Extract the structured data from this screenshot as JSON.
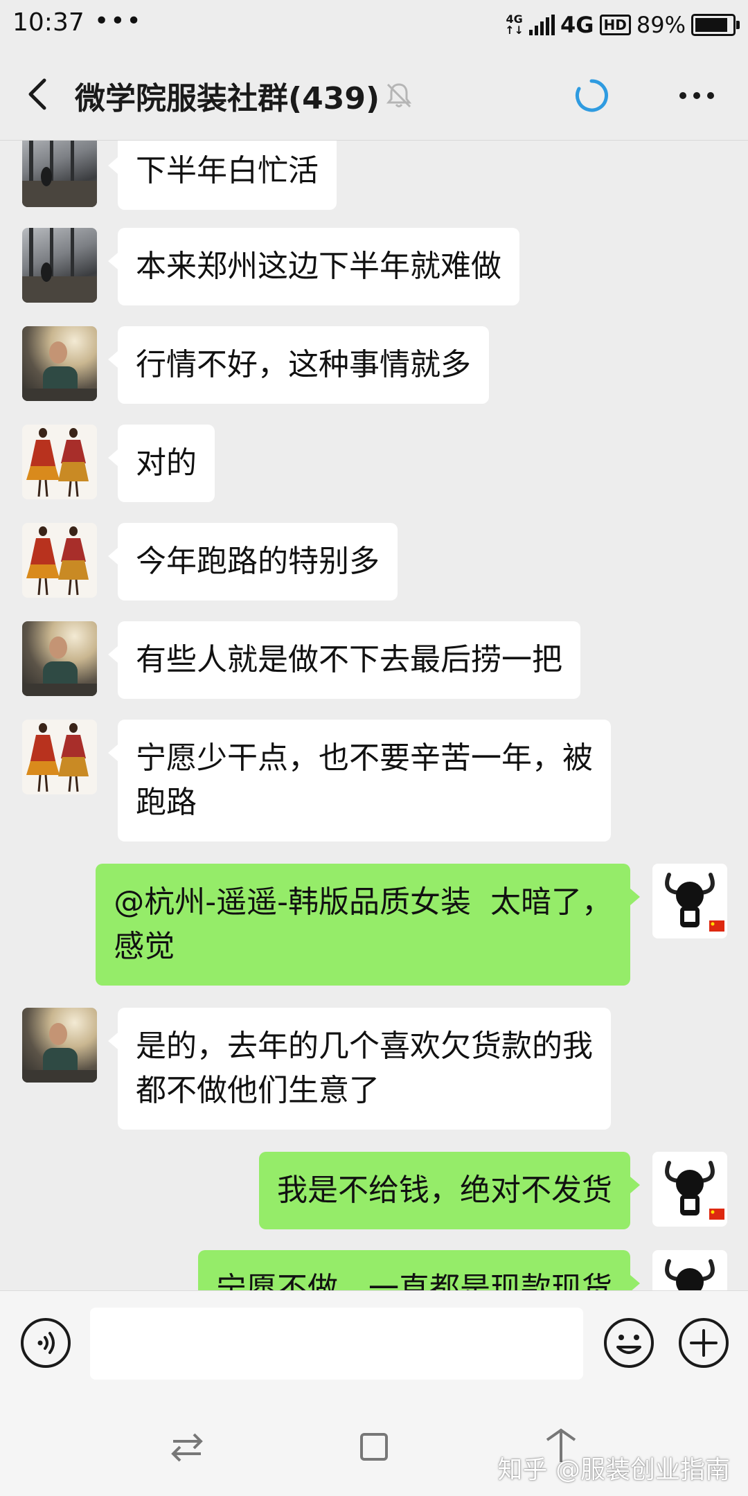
{
  "status_bar": {
    "time": "10:37",
    "dots": "•••",
    "mini_net": "4G",
    "network": "4G",
    "hd": "HD",
    "battery_percent": "89%",
    "battery_level": 0.89
  },
  "header": {
    "title": "微学院服装社群(439)",
    "accent_color": "#2f9be0"
  },
  "messages": [
    {
      "side": "left",
      "avatar": "room-photo",
      "text": "下半年白忙活"
    },
    {
      "side": "left",
      "avatar": "room-photo",
      "text": "本来郑州这边下半年就难做"
    },
    {
      "side": "left",
      "avatar": "man-photo",
      "text": "行情不好，这种事情就多"
    },
    {
      "side": "left",
      "avatar": "fashion-illustration",
      "text": "对的"
    },
    {
      "side": "left",
      "avatar": "fashion-illustration",
      "text": "今年跑路的特别多"
    },
    {
      "side": "left",
      "avatar": "man-photo",
      "text": "有些人就是做不下去最后捞一把"
    },
    {
      "side": "left",
      "avatar": "fashion-illustration",
      "text": "宁愿少干点，也不要辛苦一年，被\n跑路"
    },
    {
      "side": "right",
      "avatar": "cartoon-bull",
      "text": "@杭州-遥遥-韩版品质女装  太暗了，\n感觉"
    },
    {
      "side": "left",
      "avatar": "man-photo",
      "text": "是的，去年的几个喜欢欠货款的我\n都不做他们生意了"
    },
    {
      "side": "right",
      "avatar": "cartoon-bull",
      "text": "我是不给钱，绝对不发货"
    },
    {
      "side": "right",
      "avatar": "cartoon-bull",
      "text": "宁愿不做，一直都是现款现货"
    }
  ],
  "input": {
    "value": "",
    "placeholder": ""
  },
  "watermark": "知乎 @服装创业指南",
  "colors": {
    "bg": "#ededed",
    "bubble_self": "#95ec69",
    "bubble_other": "#ffffff"
  }
}
